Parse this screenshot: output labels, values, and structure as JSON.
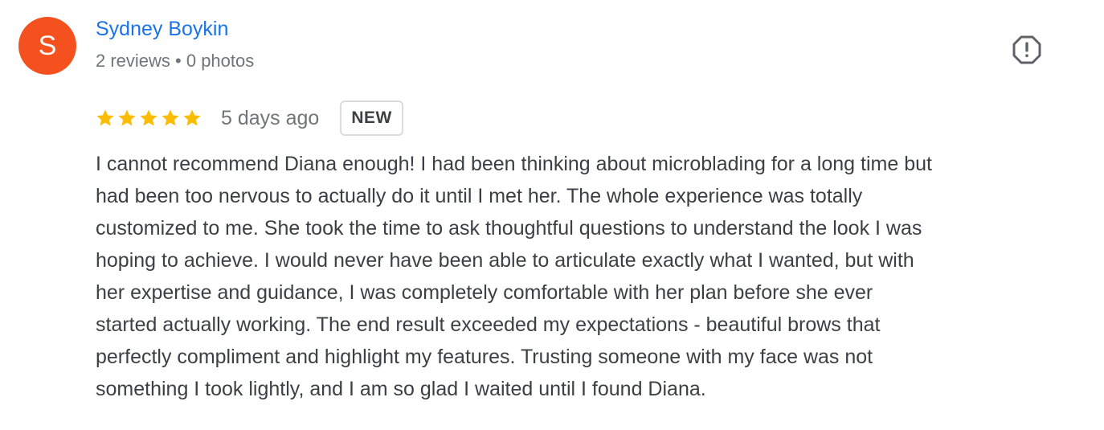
{
  "reviewer": {
    "avatar_letter": "S",
    "avatar_color": "#f4511e",
    "name": "Sydney Boykin",
    "meta": "2 reviews • 0 photos"
  },
  "actions": {
    "report_icon": "report-flag-icon"
  },
  "review": {
    "rating": 5,
    "max_rating": 5,
    "star_color": "#fbbc04",
    "date": "5 days ago",
    "badge": "NEW",
    "text_lines": [
      "I cannot recommend Diana enough! I had been thinking about microblading for a long time but",
      "had been too nervous to actually do it until I met her. The whole experience was totally",
      "customized to me. She took the time to ask thoughtful questions to understand the look I was",
      "hoping to achieve. I would never have been able to articulate exactly what I wanted, but with",
      "her expertise and guidance, I was completely comfortable with her plan before she ever",
      "started actually working. The end result exceeded my expectations - beautiful brows that",
      "perfectly compliment and highlight my features. Trusting someone with my face was not",
      "something I took lightly, and I am so glad I waited until I found Diana."
    ]
  }
}
